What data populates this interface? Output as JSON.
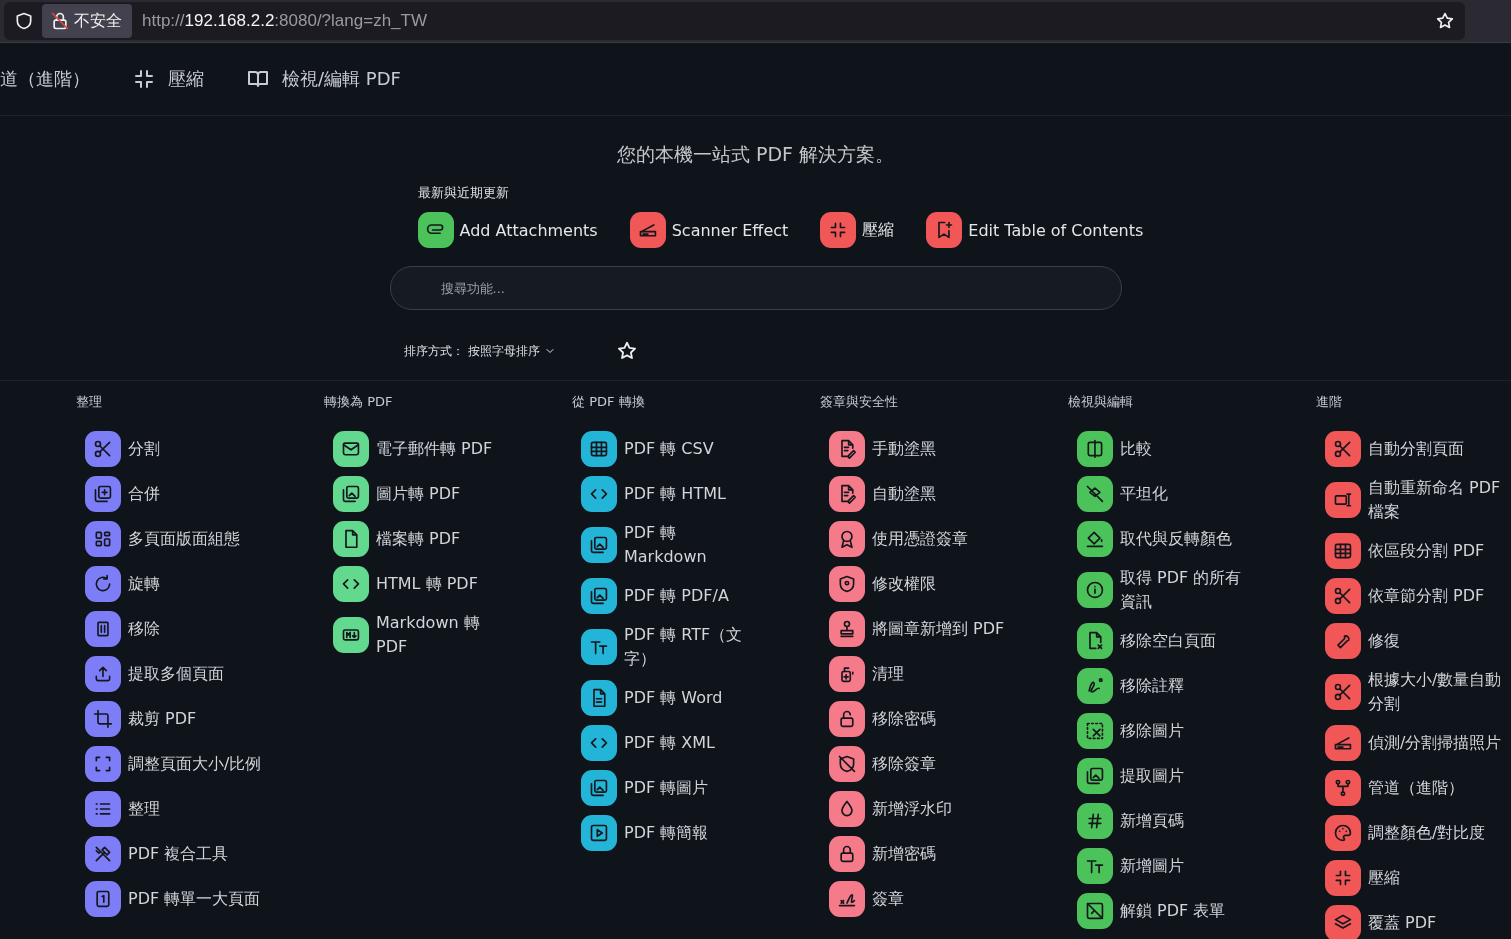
{
  "browser": {
    "security_label": "不安全",
    "url": {
      "prefix": "http://",
      "host": "192.168.2.2",
      "suffix": ":8080/?lang=zh_TW"
    }
  },
  "nav": [
    {
      "label": "道（進階）"
    },
    {
      "label": "壓縮"
    },
    {
      "label": "檢視/編輯 PDF"
    }
  ],
  "tagline": "您的本機一站式 PDF 解決方案。",
  "recent": {
    "title": "最新與近期更新",
    "items": [
      {
        "label": "Add Attachments",
        "color": "#4cc25a"
      },
      {
        "label": "Scanner Effect",
        "color": "#f25757"
      },
      {
        "label": "壓縮",
        "color": "#f25757"
      },
      {
        "label": "Edit Table of Contents",
        "color": "#f25757"
      }
    ]
  },
  "search": {
    "placeholder": "搜尋功能..."
  },
  "sort": {
    "label": "排序方式：",
    "value": "按照字母排序"
  },
  "categories": [
    {
      "title": "整理",
      "color": "#7d7ef7",
      "items": [
        "分割",
        "合併",
        "多頁面版面組態",
        "旋轉",
        "移除",
        "提取多個頁面",
        "裁剪 PDF",
        "調整頁面大小/比例",
        "整理",
        "PDF 複合工具",
        "PDF 轉單一大頁面"
      ]
    },
    {
      "title": "轉換為 PDF",
      "color": "#62d98e",
      "items": [
        "電子郵件轉 PDF",
        "圖片轉 PDF",
        "檔案轉 PDF",
        "HTML 轉 PDF",
        "Markdown 轉 PDF"
      ]
    },
    {
      "title": "從 PDF 轉換",
      "color": "#22b5d8",
      "items": [
        "PDF 轉 CSV",
        "PDF 轉 HTML",
        "PDF 轉 Markdown",
        "PDF 轉 PDF/A",
        "PDF 轉 RTF（文字）",
        "PDF 轉 Word",
        "PDF 轉 XML",
        "PDF 轉圖片",
        "PDF 轉簡報"
      ]
    },
    {
      "title": "簽章與安全性",
      "color": "#f57a8a",
      "items": [
        "手動塗黑",
        "自動塗黑",
        "使用憑證簽章",
        "修改權限",
        "將圖章新增到 PDF",
        "清理",
        "移除密碼",
        "移除簽章",
        "新增浮水印",
        "新增密碼",
        "簽章"
      ]
    },
    {
      "title": "檢視與編輯",
      "color": "#4cc25a",
      "items": [
        "比較",
        "平坦化",
        "取代與反轉顏色",
        "取得 PDF 的所有資訊",
        "移除空白頁面",
        "移除註釋",
        "移除圖片",
        "提取圖片",
        "新增頁碼",
        "新增圖片",
        "解鎖 PDF 表單"
      ]
    },
    {
      "title": "進階",
      "color": "#f25757",
      "items": [
        "自動分割頁面",
        "自動重新命名 PDF 檔案",
        "依區段分割 PDF",
        "依章節分割 PDF",
        "修復",
        "根據大小/數量自動分割",
        "偵測/分割掃描照片",
        "管道（進階）",
        "調整顏色/對比度",
        "壓縮",
        "覆蓋 PDF"
      ]
    }
  ]
}
